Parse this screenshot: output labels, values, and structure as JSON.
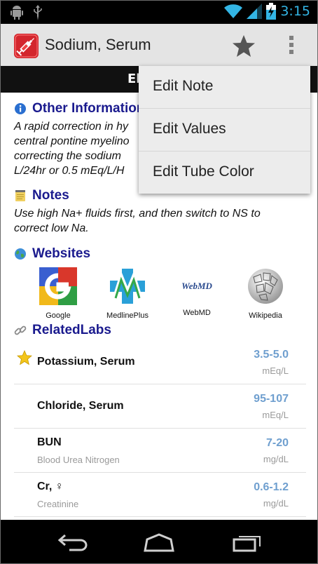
{
  "status_bar": {
    "time": "3:15"
  },
  "action_bar": {
    "title": "Sodium, Serum",
    "tab_label_visible": "El"
  },
  "sections": {
    "other_information": {
      "title": "Other Information",
      "lines": [
        "A rapid correction in hy",
        "central pontine myelino",
        "correcting the sodium",
        "L/24hr or 0.5 mEq/L/H"
      ]
    },
    "notes": {
      "title": "Notes",
      "lines": [
        "Use high Na+ fluids first, and then switch to NS to",
        "correct low Na."
      ]
    },
    "websites": {
      "title": "Websites",
      "items": [
        {
          "name": "Google",
          "logo_text": ""
        },
        {
          "name": "MedlinePlus",
          "logo_text": ""
        },
        {
          "name": "WebMD",
          "logo_text": "WebMD"
        },
        {
          "name": "Wikipedia",
          "logo_text": ""
        }
      ]
    },
    "related_labs": {
      "title": "RelatedLabs",
      "items": [
        {
          "name": "Potassium, Serum",
          "subtitle": "",
          "range": "3.5-5.0",
          "unit": "mEq/L",
          "starred": true
        },
        {
          "name": "Chloride, Serum",
          "subtitle": "",
          "range": "95-107",
          "unit": "mEq/L",
          "starred": false
        },
        {
          "name": "BUN",
          "subtitle": "Blood Urea Nitrogen",
          "range": "7-20",
          "unit": "mg/dL",
          "starred": false
        },
        {
          "name": "Cr, ♀",
          "subtitle": "Creatinine",
          "range": "0.6-1.2",
          "unit": "mg/dL",
          "starred": false
        }
      ]
    }
  },
  "overflow_menu": {
    "items": [
      "Edit Note",
      "Edit Values",
      "Edit Tube Color"
    ]
  },
  "colors": {
    "accent_clock": "#33b5e5",
    "section_title": "#1a1a8e",
    "range_value": "#6f9fcf",
    "app_icon": "#d3262d"
  },
  "icons": {
    "android_debug": "android-icon",
    "usb": "usb-icon",
    "wifi": "wifi-icon",
    "signal": "signal-icon",
    "battery": "battery-charging-icon",
    "favorite": "star-icon",
    "overflow": "overflow-menu-icon",
    "info": "info-icon",
    "notes": "note-icon",
    "websites": "globe-icon",
    "related": "link-icon",
    "nav_back": "back-icon",
    "nav_home": "home-icon",
    "nav_recents": "recents-icon"
  }
}
